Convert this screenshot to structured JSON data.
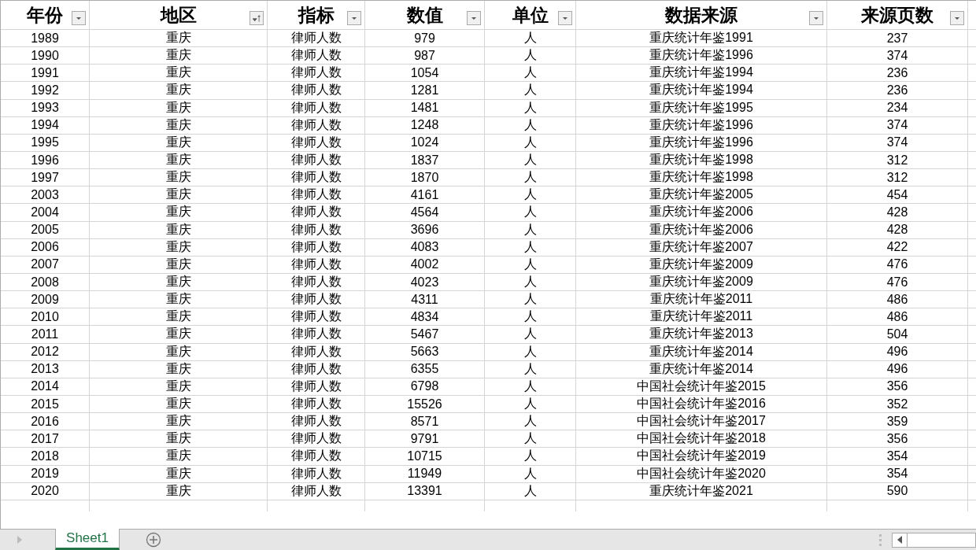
{
  "table": {
    "columns": [
      {
        "label": "年份",
        "sorted": false
      },
      {
        "label": "地区",
        "sorted": true
      },
      {
        "label": "指标",
        "sorted": false
      },
      {
        "label": "数值",
        "sorted": false
      },
      {
        "label": "单位",
        "sorted": false
      },
      {
        "label": "数据来源",
        "sorted": false
      },
      {
        "label": "来源页数",
        "sorted": false
      }
    ],
    "rows": [
      [
        "1989",
        "重庆",
        "律师人数",
        "979",
        "人",
        "重庆统计年鉴1991",
        "237"
      ],
      [
        "1990",
        "重庆",
        "律师人数",
        "987",
        "人",
        "重庆统计年鉴1996",
        "374"
      ],
      [
        "1991",
        "重庆",
        "律师人数",
        "1054",
        "人",
        "重庆统计年鉴1994",
        "236"
      ],
      [
        "1992",
        "重庆",
        "律师人数",
        "1281",
        "人",
        "重庆统计年鉴1994",
        "236"
      ],
      [
        "1993",
        "重庆",
        "律师人数",
        "1481",
        "人",
        "重庆统计年鉴1995",
        "234"
      ],
      [
        "1994",
        "重庆",
        "律师人数",
        "1248",
        "人",
        "重庆统计年鉴1996",
        "374"
      ],
      [
        "1995",
        "重庆",
        "律师人数",
        "1024",
        "人",
        "重庆统计年鉴1996",
        "374"
      ],
      [
        "1996",
        "重庆",
        "律师人数",
        "1837",
        "人",
        "重庆统计年鉴1998",
        "312"
      ],
      [
        "1997",
        "重庆",
        "律师人数",
        "1870",
        "人",
        "重庆统计年鉴1998",
        "312"
      ],
      [
        "2003",
        "重庆",
        "律师人数",
        "4161",
        "人",
        "重庆统计年鉴2005",
        "454"
      ],
      [
        "2004",
        "重庆",
        "律师人数",
        "4564",
        "人",
        "重庆统计年鉴2006",
        "428"
      ],
      [
        "2005",
        "重庆",
        "律师人数",
        "3696",
        "人",
        "重庆统计年鉴2006",
        "428"
      ],
      [
        "2006",
        "重庆",
        "律师人数",
        "4083",
        "人",
        "重庆统计年鉴2007",
        "422"
      ],
      [
        "2007",
        "重庆",
        "律师人数",
        "4002",
        "人",
        "重庆统计年鉴2009",
        "476"
      ],
      [
        "2008",
        "重庆",
        "律师人数",
        "4023",
        "人",
        "重庆统计年鉴2009",
        "476"
      ],
      [
        "2009",
        "重庆",
        "律师人数",
        "4311",
        "人",
        "重庆统计年鉴2011",
        "486"
      ],
      [
        "2010",
        "重庆",
        "律师人数",
        "4834",
        "人",
        "重庆统计年鉴2011",
        "486"
      ],
      [
        "2011",
        "重庆",
        "律师人数",
        "5467",
        "人",
        "重庆统计年鉴2013",
        "504"
      ],
      [
        "2012",
        "重庆",
        "律师人数",
        "5663",
        "人",
        "重庆统计年鉴2014",
        "496"
      ],
      [
        "2013",
        "重庆",
        "律师人数",
        "6355",
        "人",
        "重庆统计年鉴2014",
        "496"
      ],
      [
        "2014",
        "重庆",
        "律师人数",
        "6798",
        "人",
        "中国社会统计年鉴2015",
        "356"
      ],
      [
        "2015",
        "重庆",
        "律师人数",
        "15526",
        "人",
        "中国社会统计年鉴2016",
        "352"
      ],
      [
        "2016",
        "重庆",
        "律师人数",
        "8571",
        "人",
        "中国社会统计年鉴2017",
        "359"
      ],
      [
        "2017",
        "重庆",
        "律师人数",
        "9791",
        "人",
        "中国社会统计年鉴2018",
        "356"
      ],
      [
        "2018",
        "重庆",
        "律师人数",
        "10715",
        "人",
        "中国社会统计年鉴2019",
        "354"
      ],
      [
        "2019",
        "重庆",
        "律师人数",
        "11949",
        "人",
        "中国社会统计年鉴2020",
        "354"
      ],
      [
        "2020",
        "重庆",
        "律师人数",
        "13391",
        "人",
        "重庆统计年鉴2021",
        "590"
      ]
    ]
  },
  "sheet_tabs": [
    {
      "label": "Sheet1",
      "selected": true
    }
  ]
}
